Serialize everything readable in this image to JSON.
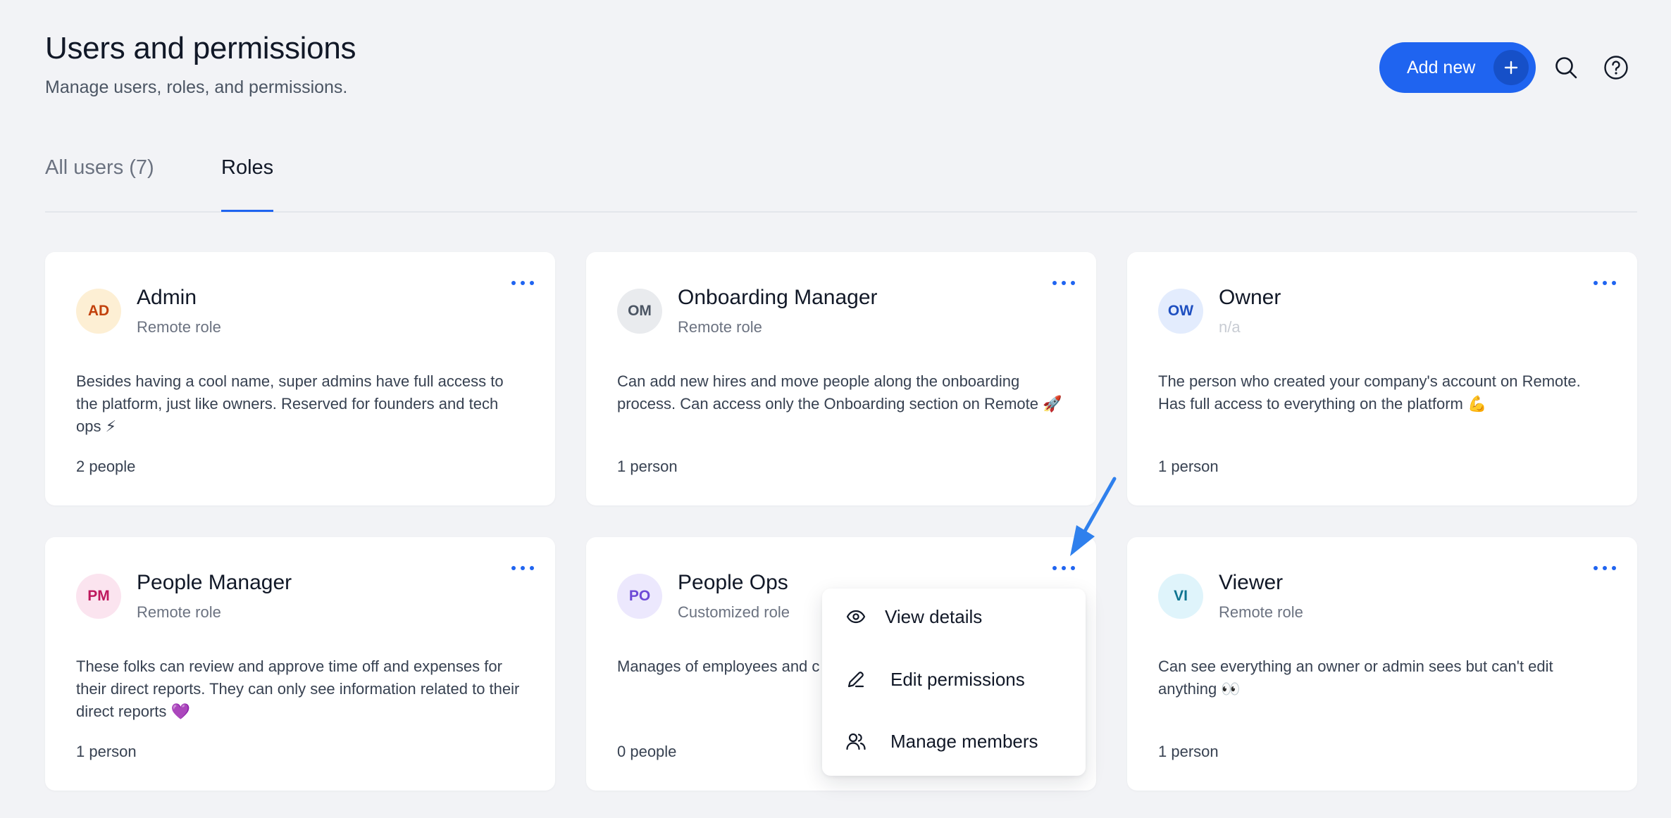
{
  "header": {
    "title": "Users and permissions",
    "subtitle": "Manage users, roles, and permissions.",
    "add_new_label": "Add new"
  },
  "tabs": [
    {
      "label": "All users (7)",
      "active": false
    },
    {
      "label": "Roles",
      "active": true
    }
  ],
  "cards": [
    {
      "initials": "AD",
      "title": "Admin",
      "subtitle": "Remote role",
      "description": "Besides having a cool name, super admins have full access to the platform, just like owners. Reserved for founders and tech ops ⚡",
      "count": "2 people",
      "avatar_bg": "#fdefd4",
      "avatar_fg": "#c2410c"
    },
    {
      "initials": "OM",
      "title": "Onboarding Manager",
      "subtitle": "Remote role",
      "description": "Can add new hires and move people along the onboarding process. Can access only the Onboarding section on Remote 🚀",
      "count": "1 person",
      "avatar_bg": "#e9ebee",
      "avatar_fg": "#4b5563"
    },
    {
      "initials": "OW",
      "title": "Owner",
      "subtitle": "n/a",
      "description": "The person who created your company's account on Remote. Has full access to everything on the platform 💪",
      "count": "1 person",
      "avatar_bg": "#e3ecfd",
      "avatar_fg": "#1e4fc0"
    },
    {
      "initials": "PM",
      "title": "People Manager",
      "subtitle": "Remote role",
      "description": "These folks can review and approve time off and expenses for their direct reports. They can only see information related to their direct reports 💜",
      "count": "1 person",
      "avatar_bg": "#fbe4ef",
      "avatar_fg": "#be185d"
    },
    {
      "initials": "PO",
      "title": "People Ops",
      "subtitle": "Customized role",
      "description": "Manages of employees and c",
      "count": "0 people",
      "avatar_bg": "#ece8fd",
      "avatar_fg": "#6d4ad6"
    },
    {
      "initials": "VI",
      "title": "Viewer",
      "subtitle": "Remote role",
      "description": "Can see everything an owner or admin sees but can't edit anything 👀",
      "count": "1 person",
      "avatar_bg": "#dff4fb",
      "avatar_fg": "#0e7490"
    }
  ],
  "menu": {
    "items": [
      {
        "label": "View details",
        "icon": "eye-icon"
      },
      {
        "label": "Edit permissions",
        "icon": "pencil-icon"
      },
      {
        "label": "Manage members",
        "icon": "users-icon"
      }
    ]
  },
  "colors": {
    "accent": "#1f64f0",
    "background": "#f2f3f6"
  }
}
